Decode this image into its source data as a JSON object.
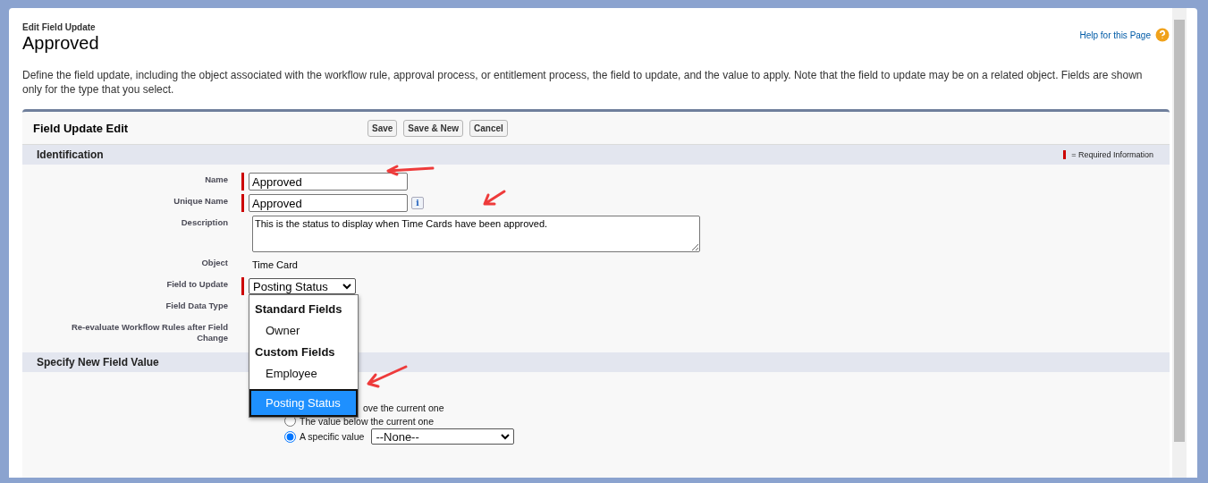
{
  "header": {
    "subtitle": "Edit Field Update",
    "title": "Approved",
    "help_link": "Help for this Page"
  },
  "intro": "Define the field update, including the object associated with the workflow rule, approval process, or entitlement process, the field to update, and the value to apply. Note that the field to update may be on a related object. Fields are shown only for the type that you select.",
  "panel": {
    "title": "Field Update Edit",
    "buttons": [
      "Save",
      "Save & New",
      "Cancel"
    ]
  },
  "identification": {
    "title": "Identification",
    "required_legend": "= Required Information",
    "fields": [
      {
        "label": "Name",
        "kind": "input",
        "required": true,
        "value": "Approved"
      },
      {
        "label": "Unique Name",
        "kind": "input",
        "required": true,
        "value": "Approved",
        "info_icon": "i"
      },
      {
        "label": "Description",
        "kind": "textarea",
        "required": false,
        "value": "This is the status to display when Time Cards have been approved."
      },
      {
        "label": "Object",
        "kind": "text",
        "required": false,
        "value": "Time Card"
      },
      {
        "label": "Field to Update",
        "kind": "select",
        "required": true,
        "value": "Posting Status"
      },
      {
        "label": "Field Data Type",
        "kind": "text",
        "required": false
      },
      {
        "label": "Re-evaluate Workflow Rules after Field Change",
        "kind": "text",
        "required": false
      }
    ]
  },
  "dropdown": {
    "items": [
      {
        "kind": "group",
        "label": "Standard Fields"
      },
      {
        "kind": "option",
        "label": "Owner",
        "selected": false
      },
      {
        "kind": "group",
        "label": "Custom Fields"
      },
      {
        "kind": "option",
        "label": "Employee",
        "selected": false
      },
      {
        "kind": "option",
        "label": "Posting Status",
        "selected": true
      }
    ]
  },
  "new_value": {
    "title": "Specify New Field Value",
    "options": [
      {
        "label": "ove the current one",
        "kind": "covered"
      },
      {
        "label": "The value below the current one",
        "kind": "radio",
        "selected": false
      },
      {
        "label": "A specific value",
        "kind": "radio",
        "selected": true,
        "select_value": "--None--"
      }
    ]
  }
}
